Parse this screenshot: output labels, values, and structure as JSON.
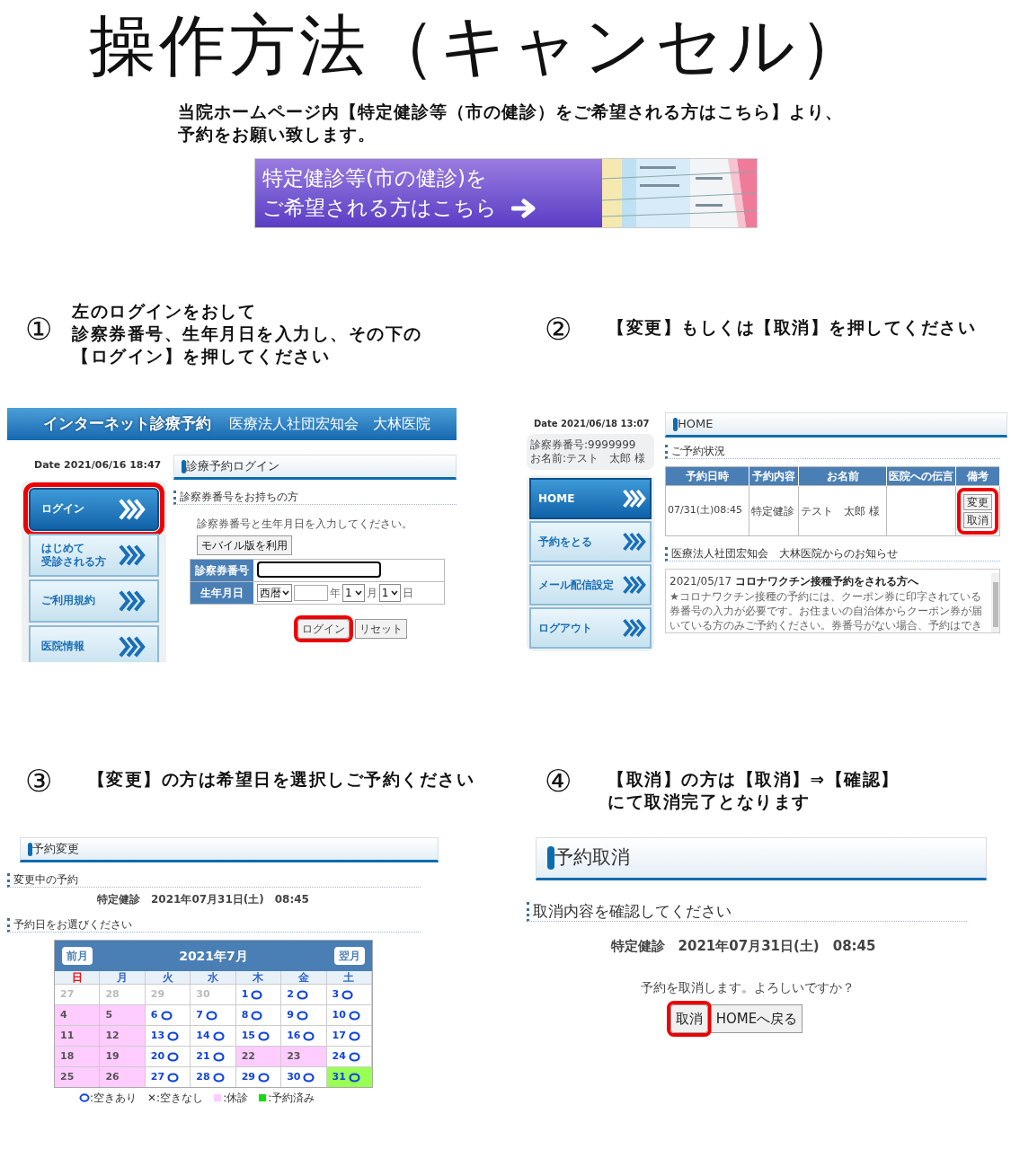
{
  "title": "操作方法（キャンセル）",
  "intro": [
    "当院ホームページ内【特定健診等（市の健診）をご希望される方はこちら】より、",
    "予約をお願い致します。"
  ],
  "banner": {
    "lines": [
      "特定健診等(市の健診)を",
      "ご希望される方はこちら"
    ]
  },
  "steps": [
    {
      "number": "①",
      "lines": [
        "左のログインをおして",
        "診察券番号、生年月日を入力し、その下の",
        "【ログイン】を押してください"
      ],
      "screen": {
        "kind": "login",
        "service": "インターネット診療予約",
        "clinic": "医療法人社団宏知会　大林医院",
        "date": "Date 2021/06/16 18:47",
        "nav": [
          {
            "lines": [
              "ログイン"
            ],
            "selected": true,
            "highlighted": true
          },
          {
            "lines": [
              "はじめて",
              "受診される方"
            ],
            "selected": false,
            "highlighted": false
          },
          {
            "lines": [
              "ご利用規約"
            ],
            "selected": false,
            "highlighted": false
          },
          {
            "lines": [
              "医院情報"
            ],
            "selected": false,
            "highlighted": false
          }
        ],
        "page_title": "診療予約ログイン",
        "section": "診察券番号をお持ちの方",
        "instruction": "診察券番号と生年月日を入力してください。",
        "mobile_button": "モバイル版を利用",
        "fields": {
          "card_label": "診察券番号",
          "birth_label": "生年月日",
          "era": "西暦",
          "year_unit": "年",
          "month": "1",
          "month_unit": "月",
          "day": "1",
          "day_unit": "日"
        },
        "buttons": [
          {
            "label": "ログイン",
            "highlighted": true
          },
          {
            "label": "リセット",
            "highlighted": false
          }
        ]
      }
    },
    {
      "number": "②",
      "lines": [
        "【変更】もしくは【取消】を押してください"
      ],
      "screen": {
        "kind": "home",
        "date": "Date 2021/06/18 13:07",
        "patient": [
          "診察券番号:9999999",
          "お名前:テスト　太郎 様"
        ],
        "nav": [
          {
            "lines": [
              "HOME"
            ],
            "selected": true,
            "highlighted": false
          },
          {
            "lines": [
              "予約をとる"
            ],
            "selected": false,
            "highlighted": false
          },
          {
            "lines": [
              "メール配信設定"
            ],
            "selected": false,
            "highlighted": false
          },
          {
            "lines": [
              "ログアウト"
            ],
            "selected": false,
            "highlighted": false
          }
        ],
        "page_title": "HOME",
        "section": "ご予約状況",
        "table": {
          "columns": [
            "予約日時",
            "予約内容",
            "お名前",
            "医院への伝言",
            "備考"
          ],
          "rows": [
            {
              "cells": [
                "07/31(土)08:45",
                "特定健診",
                "テスト　太郎 様"
              ],
              "actions": [
                "変更",
                "取消"
              ],
              "highlighted": true
            }
          ]
        },
        "news_title": "医療法人社団宏知会　大林医院からのお知らせ",
        "news": {
          "date": "2021/05/17",
          "headline": "コロナワクチン接種予約をされる方へ",
          "body_lines": [
            "★コロナワクチン接種の予約には、クーポン券に印字されている",
            "券番号の入力が必要です。お住まいの自治体からクーポン券が届",
            "いている方のみご予約ください。券番号がない場合、予約はでき"
          ]
        }
      }
    },
    {
      "number": "③",
      "lines": [
        "【変更】の方は希望日を選択しご予約ください"
      ],
      "screen": {
        "kind": "change",
        "page_title": "予約変更",
        "current_label": "変更中の予約",
        "current": "特定健診　2021年07月31日(土)　08:45",
        "choose_label": "予約日をお選びください",
        "calendar": {
          "prev": "前月",
          "month": "2021年7月",
          "next": "翌月",
          "weekdays": [
            {
              "label": "日",
              "color": "#ee1111"
            },
            {
              "label": "月",
              "color": "#3366cc"
            },
            {
              "label": "火",
              "color": "#3366cc"
            },
            {
              "label": "水",
              "color": "#3366cc"
            },
            {
              "label": "木",
              "color": "#3366cc"
            },
            {
              "label": "金",
              "color": "#3366cc"
            },
            {
              "label": "土",
              "color": "#3366cc"
            }
          ],
          "weeks": [
            [
              {
                "day": "27",
                "kind": "past"
              },
              {
                "day": "28",
                "kind": "past"
              },
              {
                "day": "29",
                "kind": "past"
              },
              {
                "day": "30",
                "kind": "past"
              },
              {
                "day": "1",
                "kind": "open"
              },
              {
                "day": "2",
                "kind": "open"
              },
              {
                "day": "3",
                "kind": "open"
              }
            ],
            [
              {
                "day": "4",
                "kind": "closed"
              },
              {
                "day": "5",
                "kind": "closed"
              },
              {
                "day": "6",
                "kind": "open"
              },
              {
                "day": "7",
                "kind": "open"
              },
              {
                "day": "8",
                "kind": "open"
              },
              {
                "day": "9",
                "kind": "open"
              },
              {
                "day": "10",
                "kind": "open"
              }
            ],
            [
              {
                "day": "11",
                "kind": "closed"
              },
              {
                "day": "12",
                "kind": "closed"
              },
              {
                "day": "13",
                "kind": "open"
              },
              {
                "day": "14",
                "kind": "open"
              },
              {
                "day": "15",
                "kind": "open"
              },
              {
                "day": "16",
                "kind": "open"
              },
              {
                "day": "17",
                "kind": "open"
              }
            ],
            [
              {
                "day": "18",
                "kind": "closed"
              },
              {
                "day": "19",
                "kind": "closed"
              },
              {
                "day": "20",
                "kind": "open"
              },
              {
                "day": "21",
                "kind": "open"
              },
              {
                "day": "22",
                "kind": "closed"
              },
              {
                "day": "23",
                "kind": "closed"
              },
              {
                "day": "24",
                "kind": "open"
              }
            ],
            [
              {
                "day": "25",
                "kind": "closed"
              },
              {
                "day": "26",
                "kind": "closed"
              },
              {
                "day": "27",
                "kind": "open"
              },
              {
                "day": "28",
                "kind": "open"
              },
              {
                "day": "29",
                "kind": "open"
              },
              {
                "day": "30",
                "kind": "open"
              },
              {
                "day": "31",
                "kind": "booked"
              }
            ]
          ]
        },
        "legend": [
          {
            "kind": "circle",
            "label": ":空きあり"
          },
          {
            "kind": "text",
            "label": "✕:空きなし"
          },
          {
            "kind": "swatch",
            "color": "#ffccff",
            "label": ":休診"
          },
          {
            "kind": "swatch",
            "color": "#11dd11",
            "label": ":予約済み"
          }
        ]
      }
    },
    {
      "number": "④",
      "lines": [
        "【取消】の方は【取消】⇒【確認】",
        "にて取消完了となります"
      ],
      "screen": {
        "kind": "cancel",
        "page_title": "予約取消",
        "section": "取消内容を確認してください",
        "detail": "特定健診　2021年07月31日(土)　08:45",
        "question": "予約を取消します。よろしいですか？",
        "buttons": [
          {
            "label": "取消",
            "highlighted": true
          },
          {
            "label": "HOMEへ戻る",
            "highlighted": false
          }
        ]
      }
    }
  ]
}
